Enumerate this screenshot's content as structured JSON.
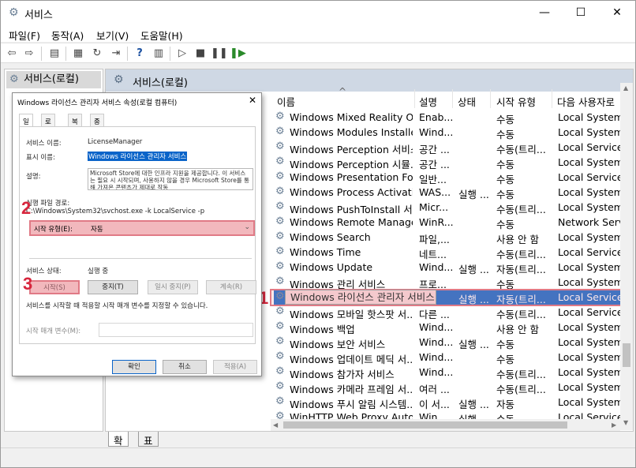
{
  "window": {
    "title": "서비스",
    "controls": {
      "minimize": "—",
      "maximize": "☐",
      "close": "✕"
    }
  },
  "menu": [
    "파일(F)",
    "동작(A)",
    "보기(V)",
    "도움말(H)"
  ],
  "tree": {
    "root": "서비스(로컬)"
  },
  "pane": {
    "header": "서비스(로컬)"
  },
  "columns": [
    "이름",
    "설명",
    "상태",
    "시작 유형",
    "다음 사용자로"
  ],
  "services": [
    {
      "name": "Windows Mixed Reality Op...",
      "desc": "Enab...",
      "status": "",
      "startup": "수동",
      "logon": "Local System"
    },
    {
      "name": "Windows Modules Installer",
      "desc": "Wind...",
      "status": "",
      "startup": "수동",
      "logon": "Local System"
    },
    {
      "name": "Windows Perception 서비스",
      "desc": "공간 ...",
      "status": "",
      "startup": "수동(트리...",
      "logon": "Local Service"
    },
    {
      "name": "Windows Perception 시뮬...",
      "desc": "공간 ...",
      "status": "",
      "startup": "수동",
      "logon": "Local System"
    },
    {
      "name": "Windows Presentation Fou...",
      "desc": "일반...",
      "status": "",
      "startup": "수동",
      "logon": "Local Service"
    },
    {
      "name": "Windows Process Activatio...",
      "desc": "WAS...",
      "status": "실행 ...",
      "startup": "수동",
      "logon": "Local System"
    },
    {
      "name": "Windows PushToInstall 서...",
      "desc": "Micr...",
      "status": "",
      "startup": "수동(트리...",
      "logon": "Local System"
    },
    {
      "name": "Windows Remote Manage...",
      "desc": "WinR...",
      "status": "",
      "startup": "수동",
      "logon": "Network Servi"
    },
    {
      "name": "Windows Search",
      "desc": "파일,...",
      "status": "",
      "startup": "사용 안 함",
      "logon": "Local System"
    },
    {
      "name": "Windows Time",
      "desc": "네트...",
      "status": "",
      "startup": "수동(트리...",
      "logon": "Local Service"
    },
    {
      "name": "Windows Update",
      "desc": "Wind...",
      "status": "실행 ...",
      "startup": "자동(트리...",
      "logon": "Local System"
    },
    {
      "name": "Windows 관리 서비스",
      "desc": "프로...",
      "status": "",
      "startup": "수동",
      "logon": "Local System"
    },
    {
      "name": "Windows 라이선스 관리자 서비스",
      "desc": "",
      "status": "실행 ...",
      "startup": "자동(트리...",
      "logon": "Local Service"
    },
    {
      "name": "Windows 모바일 핫스팟 서...",
      "desc": "다른 ...",
      "status": "",
      "startup": "수동(트리...",
      "logon": "Local Service"
    },
    {
      "name": "Windows 백업",
      "desc": "Wind...",
      "status": "",
      "startup": "사용 안 함",
      "logon": "Local System"
    },
    {
      "name": "Windows 보안 서비스",
      "desc": "Wind...",
      "status": "실행 ...",
      "startup": "수동",
      "logon": "Local System"
    },
    {
      "name": "Windows 업데이트 메딕 서...",
      "desc": "Wind...",
      "status": "",
      "startup": "수동",
      "logon": "Local System"
    },
    {
      "name": "Windows 참가자 서비스",
      "desc": "Wind...",
      "status": "",
      "startup": "수동(트리...",
      "logon": "Local System"
    },
    {
      "name": "Windows 카메라 프레임 서...",
      "desc": "여러 ...",
      "status": "",
      "startup": "수동(트리...",
      "logon": "Local System"
    },
    {
      "name": "Windows 푸시 알림 시스템...",
      "desc": "이 서...",
      "status": "실행 ...",
      "startup": "자동",
      "logon": "Local System"
    },
    {
      "name": "WinHTTP Web Proxy Auto...",
      "desc": "Win...",
      "status": "실행 ...",
      "startup": "수동",
      "logon": "Local Service"
    }
  ],
  "tooltip": "Windows 라이선스 관리자 서비스",
  "bottom_tabs": [
    "확장",
    "표준"
  ],
  "dialog": {
    "title": "Windows 라이선스 관리자 서비스 속성(로컬 컴퓨터)",
    "close": "✕",
    "tabs": [
      "일반",
      "로그온",
      "복구",
      "종속성"
    ],
    "service_name_label": "서비스 이름:",
    "service_name": "LicenseManager",
    "display_name_label": "표시 이름:",
    "display_name": "Windows 라이선스 관리자 서비스",
    "description_label": "설명:",
    "description": "Microsoft Store에 대한 인프라 지원을 제공합니다. 이 서비스는 필요 시 시작되며, 사용하지 않을 경우 Microsoft Store를 통해 가져온 콘텐츠가 제대로 작동",
    "path_label": "실행 파일 경로:",
    "path": "C:\\Windows\\System32\\svchost.exe -k LocalService -p",
    "startup_label": "시작 유형(E):",
    "startup_value": "자동",
    "status_label": "서비스 상태:",
    "status_value": "실행 중",
    "btn_start": "시작(S)",
    "btn_stop": "중지(T)",
    "btn_pause": "일시 중지(P)",
    "btn_resume": "계속(R)",
    "start_note": "서비스를 시작할 때 적용할 시작 매개 변수를 지정할 수 있습니다.",
    "param_label": "시작 매개 변수(M):",
    "ok": "확인",
    "cancel": "취소",
    "apply": "적용(A)"
  },
  "markers": [
    "1",
    "2",
    "3"
  ],
  "colors": {
    "selection": "#0a64c9",
    "highlight_fill": "#f2b8bd",
    "highlight_border": "#e07a86",
    "marker": "#d7263d"
  }
}
